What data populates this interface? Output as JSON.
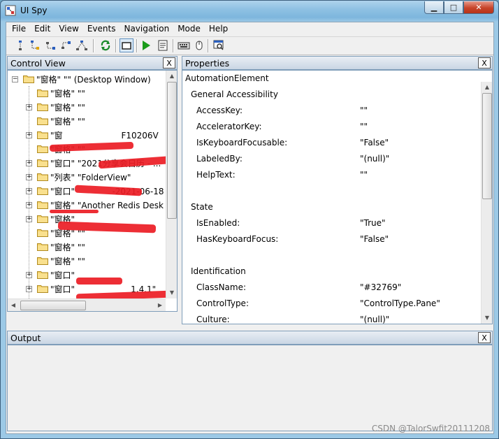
{
  "window": {
    "title": "UI Spy",
    "controls": {
      "minimize": "▁",
      "maximize": "□",
      "close": "✕"
    }
  },
  "menu": [
    "File",
    "Edit",
    "View",
    "Events",
    "Navigation",
    "Mode",
    "Help"
  ],
  "toolbar": {
    "buttons": [
      "scope-icon",
      "first-child-icon",
      "next-sibling-icon",
      "prev-sibling-icon",
      "parent-icon",
      "refresh-icon",
      "highlight-icon",
      "play-icon",
      "pattern-icon",
      "keyboard-icon",
      "mouse-icon",
      "find-icon"
    ],
    "pressed": "highlight-icon"
  },
  "control_view": {
    "title": "Control View",
    "close_label": "X",
    "root": "\"窗格\" \"\" (Desktop Window)",
    "items": [
      {
        "label": "\"窗格\" \"\"",
        "expander": false
      },
      {
        "label": "\"窗格\" \"\"",
        "expander": true
      },
      {
        "label": "\"窗格\" \"\"",
        "expander": false
      },
      {
        "label": "\"窗                      F10206V",
        "expander": true
      },
      {
        "label": "\"窗格\" \"\"",
        "expander": false
      },
      {
        "label": "\"窗口\" \"2021分享会日历 - ...",
        "expander": true
      },
      {
        "label": "\"列表\" \"FolderView\"",
        "expander": true
      },
      {
        "label": "\"窗口\"              -2021-06-18",
        "expander": true
      },
      {
        "label": "\"窗格\" \"Another Redis Desk",
        "expander": true
      },
      {
        "label": "\"窗格\"",
        "expander": true
      },
      {
        "label": "\"窗格\" \"\"",
        "expander": false
      },
      {
        "label": "\"窗格\" \"\"",
        "expander": false
      },
      {
        "label": "\"窗格\" \"\"",
        "expander": false
      },
      {
        "label": "\"窗口\"",
        "expander": true
      },
      {
        "label": "\"窗口\"                     1.4.1\"",
        "expander": true
      },
      {
        "label": "\"窗口\" \"下载\"",
        "expander": true
      }
    ]
  },
  "properties": {
    "title": "Properties",
    "close_label": "X",
    "root": "AutomationElement",
    "groups": [
      {
        "name": "General Accessibility",
        "rows": [
          {
            "name": "AccessKey:",
            "value": "\"\""
          },
          {
            "name": "AcceleratorKey:",
            "value": "\"\""
          },
          {
            "name": "IsKeyboardFocusable:",
            "value": "\"False\""
          },
          {
            "name": "LabeledBy:",
            "value": "\"(null)\""
          },
          {
            "name": "HelpText:",
            "value": "\"\""
          }
        ]
      },
      {
        "name": "State",
        "rows": [
          {
            "name": "IsEnabled:",
            "value": "\"True\""
          },
          {
            "name": "HasKeyboardFocus:",
            "value": "\"False\""
          }
        ]
      },
      {
        "name": "Identification",
        "rows": [
          {
            "name": "ClassName:",
            "value": "\"#32769\""
          },
          {
            "name": "ControlType:",
            "value": "\"ControlType.Pane\""
          },
          {
            "name": "Culture:",
            "value": "\"(null)\""
          }
        ]
      }
    ]
  },
  "output": {
    "title": "Output",
    "close_label": "X"
  },
  "watermark": "CSDN @TalorSwfit20111208",
  "colors": {
    "redaction": "#ec1c24",
    "play": "#1a9b1a",
    "folder": "#f5d36b"
  }
}
